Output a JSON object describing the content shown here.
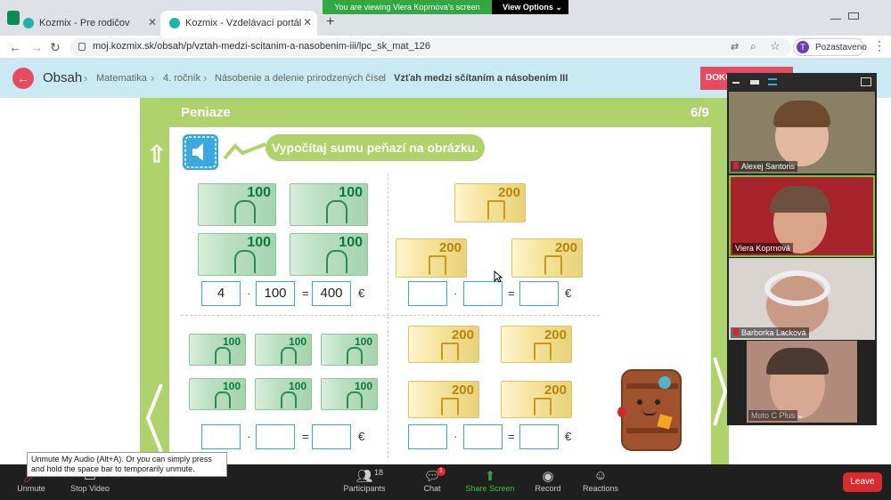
{
  "browser": {
    "tabs": [
      {
        "title": "Kozmix - Pre rodičov"
      },
      {
        "title": "Kozmix - Vzdelávací portál"
      }
    ],
    "url": "moj.kozmix.sk/obsah/p/vztah-medzi-scitanim-a-nasobenim-iii/lpc_sk_mat_126",
    "profile_initial": "T",
    "profile_label": "Pozastaveno",
    "new_tab": "+"
  },
  "zoom_banner": {
    "viewing": "You are viewing Viera Koprnova's screen",
    "view_options": "View Options ⌄"
  },
  "app": {
    "back_label": "←",
    "section": "Obsah",
    "breadcrumbs": [
      "Matematika",
      "4. ročník",
      "Násobenie a delenie prirodzených čísel",
      "Vzťah medzi sčítaním a násobením III"
    ],
    "finish_button": "DOKO"
  },
  "lesson": {
    "title": "Peniaze",
    "page": "6/9",
    "instruction": "Vypočítaj sumu peňazí na obrázku.",
    "note_value_100": "100",
    "note_value_200": "200",
    "ex1": {
      "a": "4",
      "b": "100",
      "result": "400"
    },
    "dot": "·",
    "equals": "=",
    "currency": "€"
  },
  "participants": [
    {
      "name": "Alexej Santoris"
    },
    {
      "name": "Viera Koprnová"
    },
    {
      "name": "Barborka Lacková"
    },
    {
      "name": "Moto C Plus"
    }
  ],
  "zoom_toolbar": {
    "unmute": "Unmute",
    "stop_video": "Stop Video",
    "participants": "Participants",
    "participants_count": "18",
    "chat": "Chat",
    "chat_badge": "1",
    "share_screen": "Share Screen",
    "record": "Record",
    "reactions": "Reactions",
    "leave": "Leave",
    "tooltip": "Unmute My Audio (Alt+A). Or you can simply press and hold the space bar to temporarily unmute."
  },
  "colors": {
    "green": "#aed36b",
    "accent_red": "#e84a5f",
    "blue": "#39a9e0",
    "zoom_green": "#33a744"
  }
}
